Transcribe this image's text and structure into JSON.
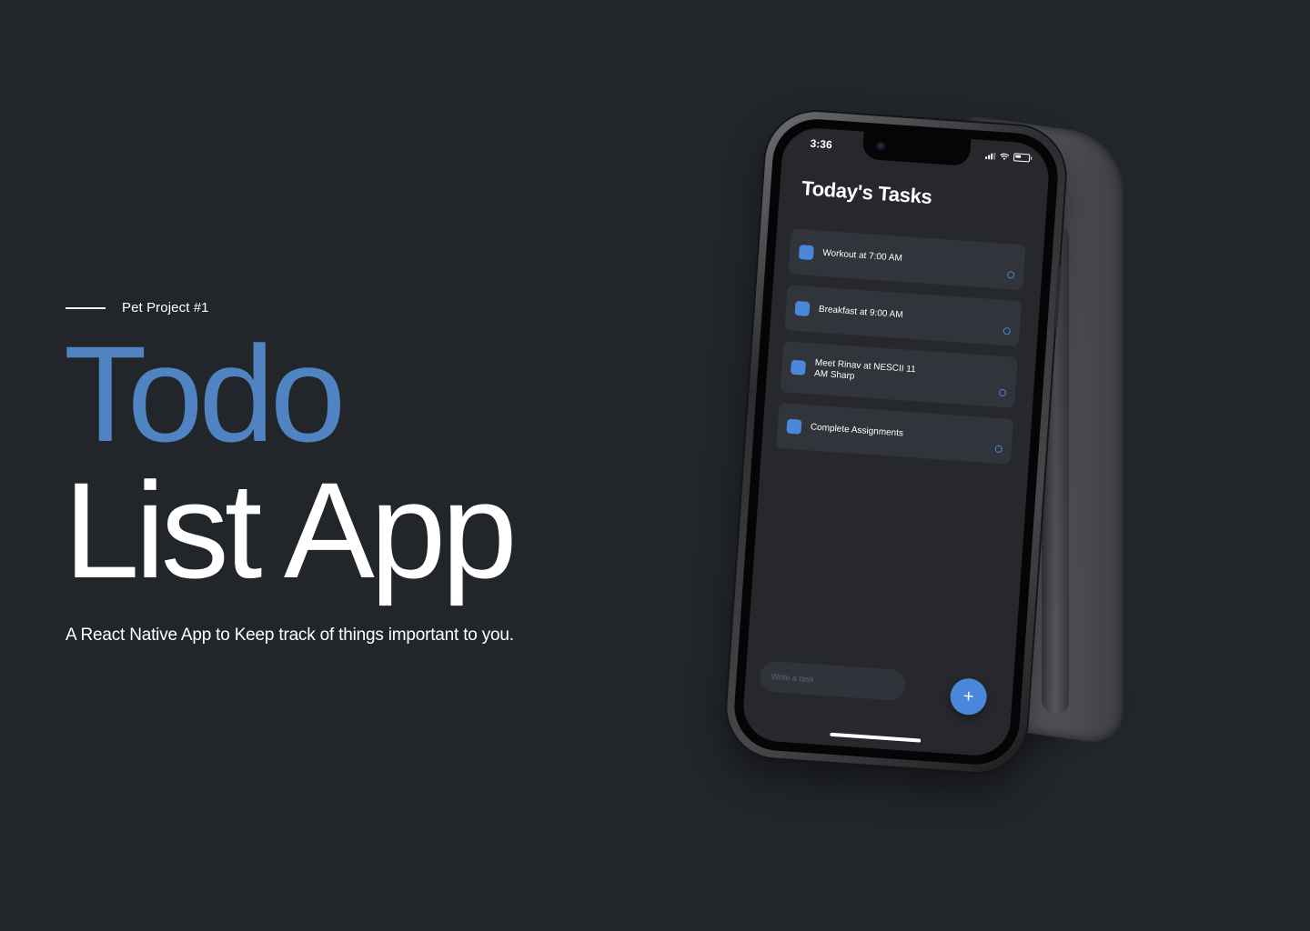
{
  "hero": {
    "eyebrow": "Pet Project #1",
    "title_line_1": "Todo",
    "title_line_2": "List App",
    "subtitle": "A React Native App to Keep track of things important to you."
  },
  "phone": {
    "status_time": "3:36",
    "status_icons": [
      "signal-icon",
      "wifi-icon",
      "battery-icon"
    ],
    "screen_title": "Today's Tasks",
    "tasks": [
      {
        "label": "Workout at 7:00 AM"
      },
      {
        "label": "Breakfast at 9:00 AM"
      },
      {
        "label": "Meet Rinav at NESCII 11 AM Sharp"
      },
      {
        "label": "Complete Assignments"
      }
    ],
    "input_placeholder": "Write a task",
    "add_label": "+"
  },
  "colors": {
    "background": "#22252a",
    "accent": "#4f83c1",
    "checkbox": "#4a86d9",
    "screen": "#26282d",
    "card": "#31343a"
  }
}
